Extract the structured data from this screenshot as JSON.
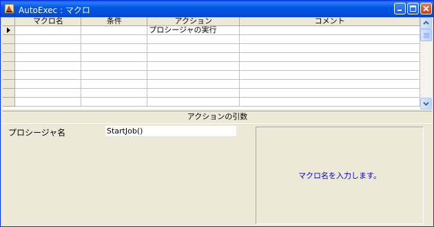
{
  "window": {
    "title": "AutoExec : マクロ"
  },
  "grid": {
    "columns": [
      "マクロ名",
      "条件",
      "アクション",
      "コメント"
    ],
    "rows": [
      [
        "",
        "",
        "プロシージャの実行",
        ""
      ],
      [
        "",
        "",
        "",
        ""
      ],
      [
        "",
        "",
        "",
        ""
      ],
      [
        "",
        "",
        "",
        ""
      ],
      [
        "",
        "",
        "",
        ""
      ],
      [
        "",
        "",
        "",
        ""
      ],
      [
        "",
        "",
        "",
        ""
      ],
      [
        "",
        "",
        "",
        ""
      ],
      [
        "",
        "",
        "",
        ""
      ]
    ]
  },
  "arguments": {
    "header": "アクションの引数",
    "procedure_label": "プロシージャ名",
    "procedure_value": "StartJob()",
    "help_text": "マクロ名を入力します。"
  },
  "icons": {
    "app": "access-macro-icon",
    "minimize": "minimize-icon",
    "maximize": "maximize-icon",
    "close": "close-icon",
    "current_row": "current-row-arrow-icon",
    "scroll_up": "scroll-up-icon",
    "scroll_down": "scroll-down-icon"
  }
}
